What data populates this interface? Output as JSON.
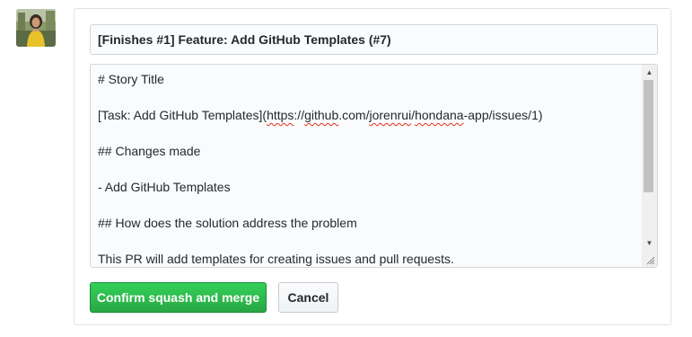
{
  "merge_form": {
    "commit_title": "[Finishes #1] Feature: Add GitHub Templates (#7)",
    "description_lines": [
      "# Story Title",
      "",
      "[Task: Add GitHub Templates](https://github.com/jorenrui/hondana-app/issues/1)",
      "",
      "## Changes made",
      "",
      "- Add GitHub Templates",
      "",
      "## How does the solution address the problem",
      "",
      "This PR will add templates for creating issues and pull requests."
    ],
    "confirm_label": "Confirm squash and merge",
    "cancel_label": "Cancel"
  },
  "colors": {
    "primary_button": "#2cbe4e",
    "border": "#e1e4e8",
    "spellcheck_underline": "#e0301e"
  },
  "icons": {
    "scroll_up": "triangle-up-icon",
    "scroll_down": "triangle-down-icon",
    "resize": "resize-grip-icon"
  }
}
